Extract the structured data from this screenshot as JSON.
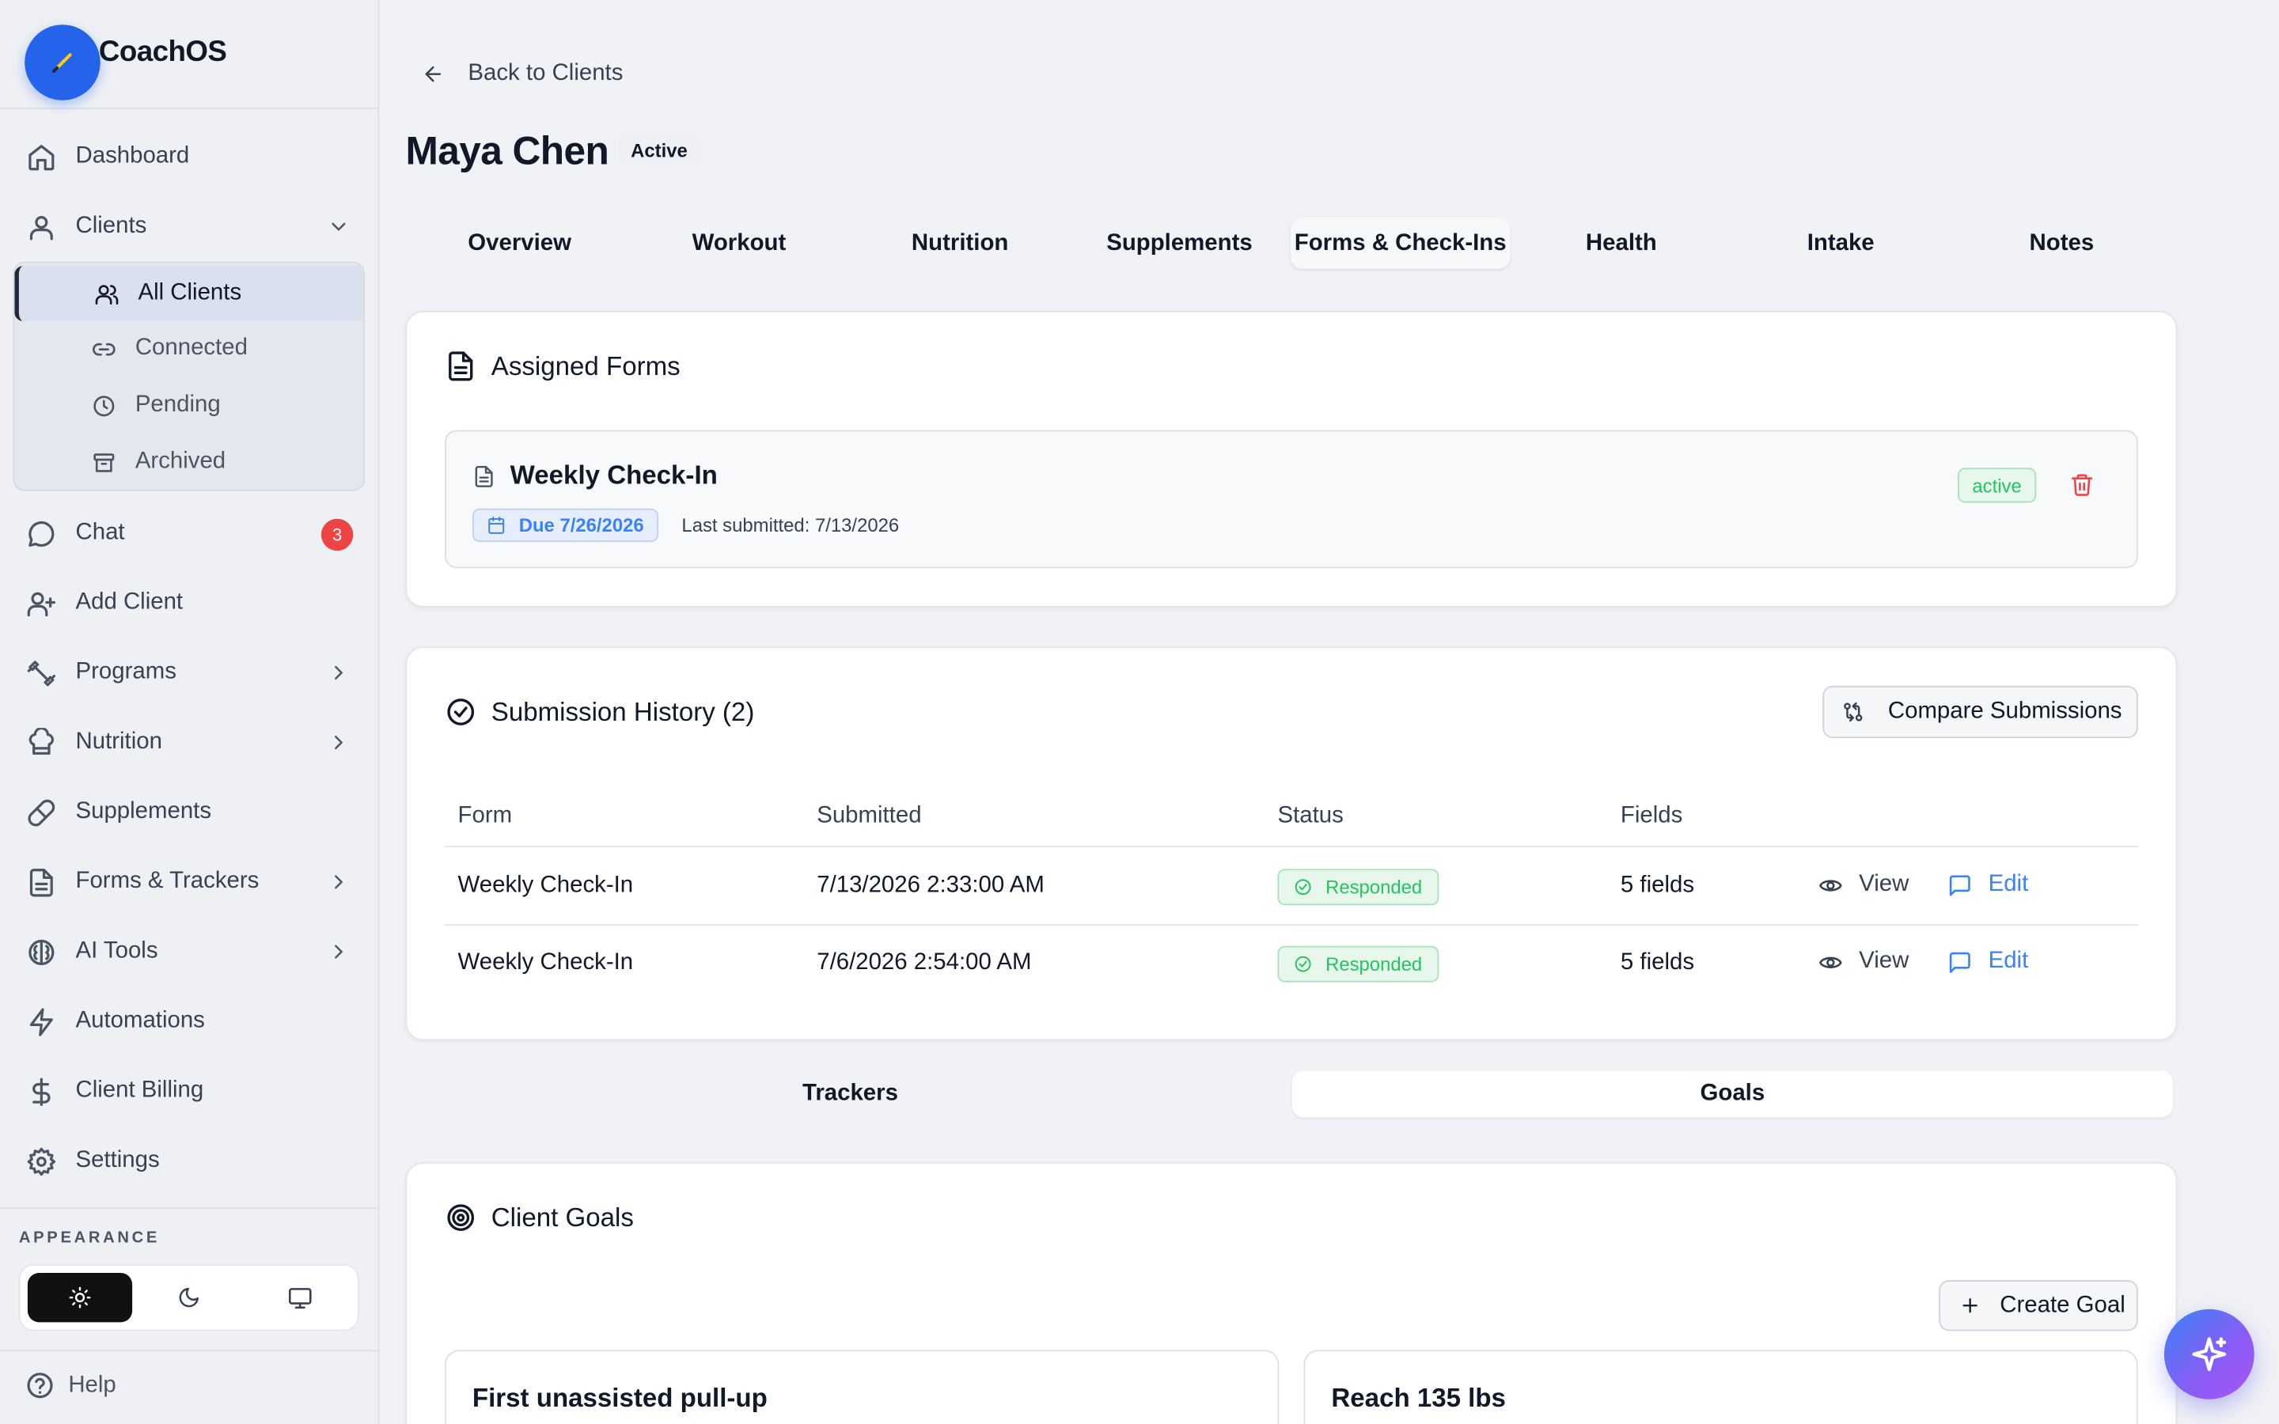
{
  "brand": {
    "name": "CoachOS"
  },
  "sidebar": {
    "items": [
      {
        "id": "dashboard",
        "label": "Dashboard"
      },
      {
        "id": "clients",
        "label": "Clients"
      },
      {
        "id": "chat",
        "label": "Chat",
        "badge": "3"
      },
      {
        "id": "add-client",
        "label": "Add Client"
      },
      {
        "id": "programs",
        "label": "Programs"
      },
      {
        "id": "nutrition",
        "label": "Nutrition"
      },
      {
        "id": "supplements",
        "label": "Supplements"
      },
      {
        "id": "forms-trackers",
        "label": "Forms & Trackers"
      },
      {
        "id": "ai-tools",
        "label": "AI Tools"
      },
      {
        "id": "automations",
        "label": "Automations"
      },
      {
        "id": "client-billing",
        "label": "Client Billing"
      },
      {
        "id": "settings",
        "label": "Settings"
      }
    ],
    "clients_sub": [
      {
        "id": "all-clients",
        "label": "All Clients"
      },
      {
        "id": "connected",
        "label": "Connected"
      },
      {
        "id": "pending",
        "label": "Pending"
      },
      {
        "id": "archived",
        "label": "Archived"
      }
    ],
    "appearance_label": "APPEARANCE",
    "help_label": "Help"
  },
  "main": {
    "back_label": "Back to Clients",
    "client_name": "Maya Chen",
    "client_status": "Active",
    "tabs": [
      "Overview",
      "Workout",
      "Nutrition",
      "Supplements",
      "Forms & Check-Ins",
      "Health",
      "Intake",
      "Notes"
    ],
    "active_tab": "Forms & Check-Ins",
    "assigned": {
      "title": "Assigned Forms",
      "form_name": "Weekly Check-In",
      "due": "Due 7/26/2026",
      "last_submitted": "Last submitted: 7/13/2026",
      "status": "active"
    },
    "history": {
      "title": "Submission History (2)",
      "compare_label": "Compare Submissions",
      "columns": [
        "Form",
        "Submitted",
        "Status",
        "Fields"
      ],
      "rows": [
        {
          "form": "Weekly Check-In",
          "submitted": "7/13/2026 2:33:00 AM",
          "status": "Responded",
          "fields": "5 fields"
        },
        {
          "form": "Weekly Check-In",
          "submitted": "7/6/2026 2:54:00 AM",
          "status": "Responded",
          "fields": "5 fields"
        }
      ],
      "view_label": "View",
      "edit_label": "Edit"
    },
    "segment": {
      "trackers": "Trackers",
      "goals": "Goals",
      "active": "Goals"
    },
    "goals": {
      "title": "Client Goals",
      "create_label": "Create Goal",
      "cards": [
        "First unassisted pull-up",
        "Reach 135 lbs"
      ]
    }
  },
  "colors": {
    "accent_blue": "#2563eb",
    "success_green": "#22c55e",
    "danger_red": "#ef4444",
    "link_blue": "#3b82f6"
  }
}
